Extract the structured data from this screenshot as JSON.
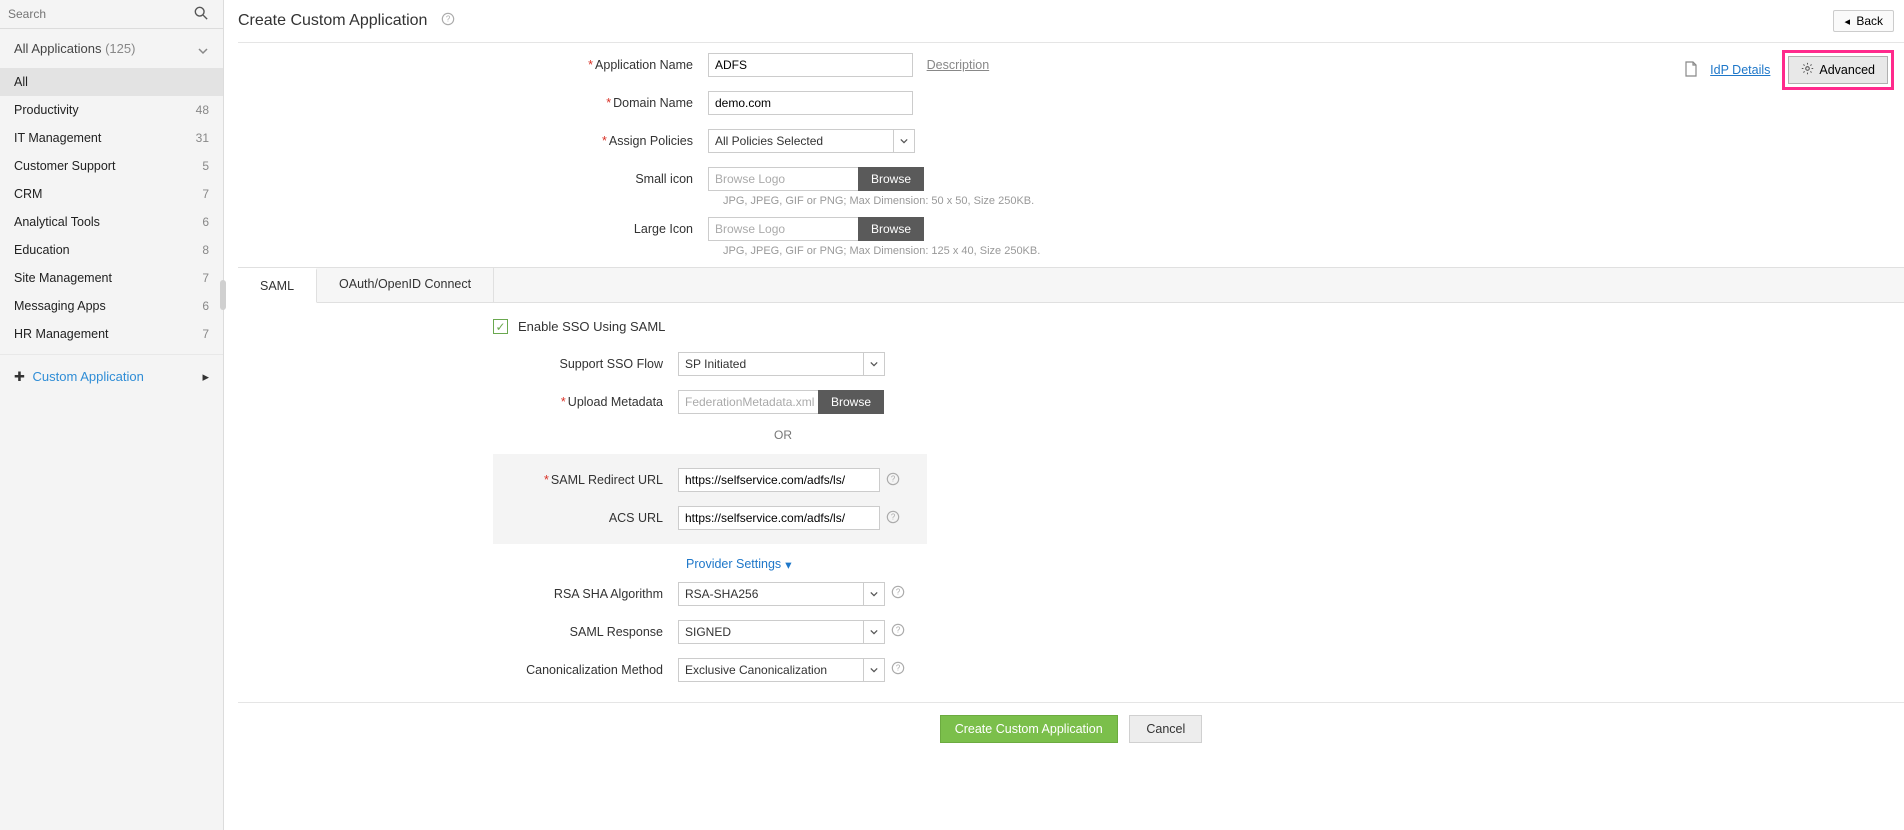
{
  "sidebar": {
    "search_placeholder": "Search",
    "all_label": "All Applications",
    "all_count": "(125)",
    "items": [
      {
        "label": "All",
        "count": ""
      },
      {
        "label": "Productivity",
        "count": "48"
      },
      {
        "label": "IT Management",
        "count": "31"
      },
      {
        "label": "Customer Support",
        "count": "5"
      },
      {
        "label": "CRM",
        "count": "7"
      },
      {
        "label": "Analytical Tools",
        "count": "6"
      },
      {
        "label": "Education",
        "count": "8"
      },
      {
        "label": "Site Management",
        "count": "7"
      },
      {
        "label": "Messaging Apps",
        "count": "6"
      },
      {
        "label": "HR Management",
        "count": "7"
      }
    ],
    "custom_app_label": "Custom Application"
  },
  "header": {
    "title": "Create Custom Application",
    "back": "Back"
  },
  "toolbar": {
    "idp_details": "IdP Details",
    "advanced": "Advanced"
  },
  "form": {
    "app_name_label": "Application Name",
    "app_name_value": "ADFS",
    "description": "Description",
    "domain_label": "Domain Name",
    "domain_value": "demo.com",
    "assign_policies_label": "Assign Policies",
    "assign_policies_value": "All Policies Selected",
    "small_icon_label": "Small icon",
    "small_icon_placeholder": "Browse Logo",
    "small_icon_hint": "JPG, JPEG, GIF or PNG; Max Dimension: 50 x 50, Size 250KB.",
    "large_icon_label": "Large Icon",
    "large_icon_placeholder": "Browse Logo",
    "large_icon_hint": "JPG, JPEG, GIF or PNG; Max Dimension: 125 x 40, Size 250KB.",
    "browse": "Browse"
  },
  "tabs": {
    "saml": "SAML",
    "oauth": "OAuth/OpenID Connect"
  },
  "saml": {
    "enable_label": "Enable SSO Using SAML",
    "support_flow_label": "Support SSO Flow",
    "support_flow_value": "SP Initiated",
    "upload_metadata_label": "Upload Metadata",
    "upload_metadata_placeholder": "FederationMetadata.xml",
    "or_text": "OR",
    "redirect_label": "SAML Redirect URL",
    "redirect_value": "https://selfservice.com/adfs/ls/",
    "acs_label": "ACS URL",
    "acs_value": "https://selfservice.com/adfs/ls/",
    "provider_settings": "Provider Settings",
    "rsa_label": "RSA SHA Algorithm",
    "rsa_value": "RSA-SHA256",
    "saml_response_label": "SAML Response",
    "saml_response_value": "SIGNED",
    "canon_label": "Canonicalization Method",
    "canon_value": "Exclusive Canonicalization"
  },
  "actions": {
    "create": "Create Custom Application",
    "cancel": "Cancel"
  }
}
